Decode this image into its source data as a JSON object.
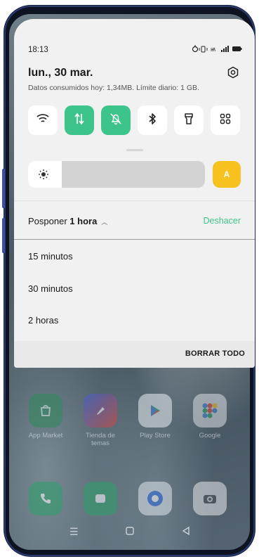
{
  "status_bar": {
    "time": "18:13",
    "icons": [
      "alarm-icon",
      "vibrate-icon",
      "volte-icon",
      "signal-4g-icon",
      "battery-icon"
    ]
  },
  "header": {
    "date": "lun., 30 mar.",
    "data_usage": "Datos consumidos hoy: 1,34MB. Límite diario: 1 GB."
  },
  "quick_tiles": [
    {
      "name": "wifi",
      "icon": "wifi-icon",
      "active": false
    },
    {
      "name": "mobile-data",
      "icon": "data-arrows-icon",
      "active": true
    },
    {
      "name": "do-not-disturb",
      "icon": "bell-off-icon",
      "active": true
    },
    {
      "name": "bluetooth",
      "icon": "bluetooth-icon",
      "active": false
    },
    {
      "name": "flashlight",
      "icon": "flashlight-icon",
      "active": false
    },
    {
      "name": "edit-tiles",
      "icon": "grid-icon",
      "active": false
    }
  ],
  "brightness": {
    "level": 0.19,
    "auto_label": "A"
  },
  "snooze": {
    "prefix": "Posponer",
    "selected": "1 hora",
    "undo_label": "Deshacer",
    "options": [
      "15 minutos",
      "30 minutos",
      "2 horas"
    ]
  },
  "footer": {
    "clear_all": "BORRAR TODO"
  },
  "home_apps": [
    {
      "label": "App Market",
      "color": "#2e8a5b"
    },
    {
      "label": "Tienda de temas",
      "color": "#c8452f"
    },
    {
      "label": "Play Store",
      "color": "#e9eef2"
    },
    {
      "label": "Google",
      "color": "#d9dde0"
    }
  ],
  "colors": {
    "accent_green": "#3dc48a",
    "auto_yellow": "#f7c21d",
    "panel_bg": "#f1f1f1"
  }
}
